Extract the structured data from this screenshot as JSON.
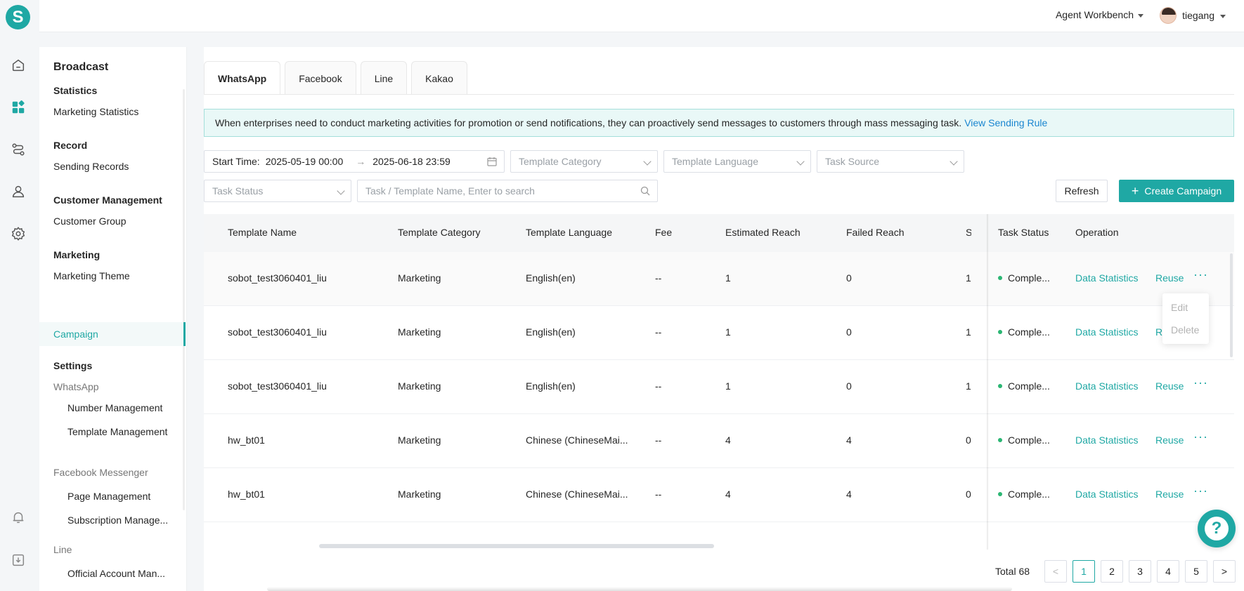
{
  "header": {
    "workbench": "Agent Workbench",
    "user": "tiegang"
  },
  "logo": "S",
  "submenu": {
    "title": "Broadcast",
    "groups": {
      "statistics": "Statistics",
      "record": "Record",
      "customer": "Customer Management",
      "marketing": "Marketing",
      "settings": "Settings"
    },
    "items": {
      "marketing_statistics": "Marketing Statistics",
      "sending_records": "Sending Records",
      "customer_group": "Customer Group",
      "marketing_theme": "Marketing Theme",
      "campaign": "Campaign",
      "whatsapp": "WhatsApp",
      "number_management": "Number Management",
      "template_management": "Template Management",
      "facebook_messenger": "Facebook Messenger",
      "page_management": "Page Management",
      "subscription_management": "Subscription Manage...",
      "line": "Line",
      "official_account": "Official Account Man..."
    }
  },
  "tabs": [
    "WhatsApp",
    "Facebook",
    "Line",
    "Kakao"
  ],
  "notice": {
    "text": "When enterprises need to conduct marketing activities for promotion or send notifications, they can proactively send messages to customers through mass messaging task.",
    "link": "View Sending Rule"
  },
  "filters": {
    "start_time_label": "Start Time:",
    "start": "2025-05-19 00:00",
    "arrow": "→",
    "end": "2025-06-18 23:59",
    "template_category": "Template Category",
    "template_language": "Template Language",
    "task_source": "Task Source",
    "task_status": "Task Status",
    "search_placeholder": "Task / Template Name, Enter to search"
  },
  "actions": {
    "refresh": "Refresh",
    "create": "Create Campaign"
  },
  "table": {
    "columns": {
      "template_name": "Template Name",
      "template_category": "Template Category",
      "template_language": "Template Language",
      "fee": "Fee",
      "estimated_reach": "Estimated Reach",
      "failed_reach": "Failed Reach",
      "partial": "S",
      "task_status": "Task Status",
      "operation": "Operation"
    },
    "rows": [
      {
        "name": "sobot_test3060401_liu",
        "category": "Marketing",
        "language": "English(en)",
        "fee": "--",
        "estimated": "1",
        "failed": "0",
        "partial": "1",
        "status": "Comple...",
        "op1": "Data Statistics",
        "op2": "Reuse",
        "more": "···"
      },
      {
        "name": "sobot_test3060401_liu",
        "category": "Marketing",
        "language": "English(en)",
        "fee": "--",
        "estimated": "1",
        "failed": "0",
        "partial": "1",
        "status": "Comple...",
        "op1": "Data Statistics",
        "op2": "Reuse",
        "more": "···"
      },
      {
        "name": "sobot_test3060401_liu",
        "category": "Marketing",
        "language": "English(en)",
        "fee": "--",
        "estimated": "1",
        "failed": "0",
        "partial": "1",
        "status": "Comple...",
        "op1": "Data Statistics",
        "op2": "Reuse",
        "more": "···"
      },
      {
        "name": "hw_bt01",
        "category": "Marketing",
        "language": "Chinese (ChineseMai...",
        "fee": "--",
        "estimated": "4",
        "failed": "4",
        "partial": "0",
        "status": "Comple...",
        "op1": "Data Statistics",
        "op2": "Reuse",
        "more": "···"
      },
      {
        "name": "hw_bt01",
        "category": "Marketing",
        "language": "Chinese (ChineseMai...",
        "fee": "--",
        "estimated": "4",
        "failed": "4",
        "partial": "0",
        "status": "Comple...",
        "op1": "Data Statistics",
        "op2": "Reuse",
        "more": "···"
      }
    ]
  },
  "row_menu": {
    "edit": "Edit",
    "delete": "Delete"
  },
  "pagination": {
    "total": "Total 68",
    "pages": [
      "1",
      "2",
      "3",
      "4",
      "5"
    ],
    "prev": "<",
    "next": ">"
  },
  "help": "?"
}
